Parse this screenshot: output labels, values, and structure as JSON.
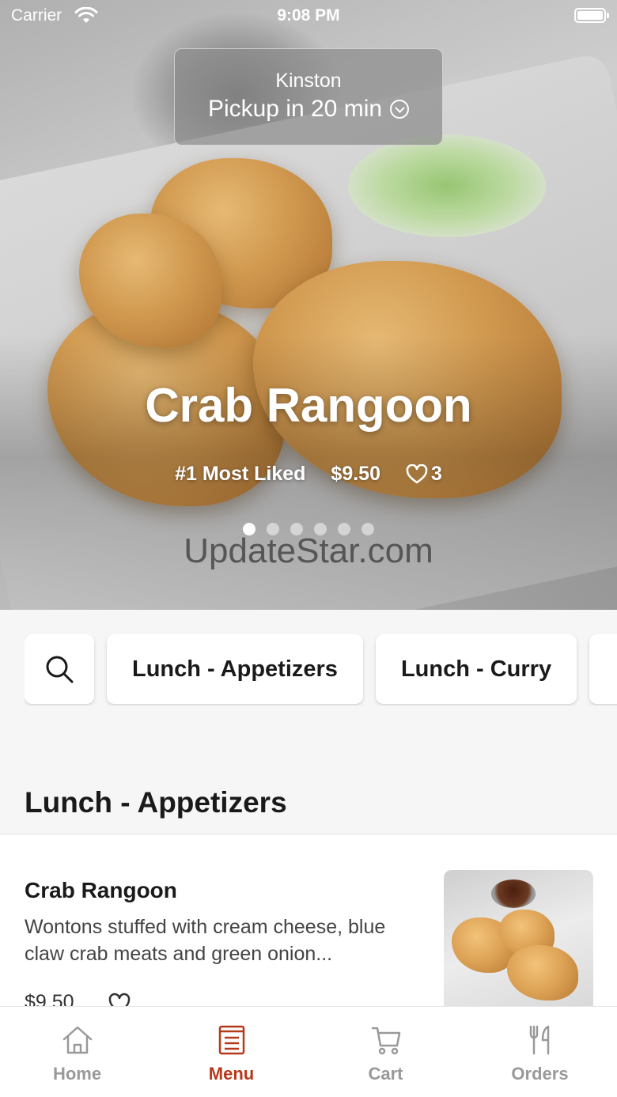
{
  "status_bar": {
    "carrier": "Carrier",
    "time": "9:08 PM"
  },
  "pickup": {
    "location": "Kinston",
    "eta": "Pickup in 20 min"
  },
  "hero": {
    "title": "Crab Rangoon",
    "rank": "#1 Most Liked",
    "price": "$9.50",
    "likes": "3",
    "slide_count": 6,
    "active_slide": 1,
    "watermark": "UpdateStar.com"
  },
  "categories": {
    "search_icon": "search-icon",
    "items": [
      "Lunch - Appetizers",
      "Lunch - Curry"
    ]
  },
  "section": {
    "title": "Lunch - Appetizers"
  },
  "menu_item": {
    "name": "Crab Rangoon",
    "description": "Wontons stuffed with cream cheese, blue claw crab meats and green onion...",
    "price": "$9.50"
  },
  "tabbar": {
    "items": [
      {
        "label": "Home",
        "icon": "home-icon"
      },
      {
        "label": "Menu",
        "icon": "menu-icon"
      },
      {
        "label": "Cart",
        "icon": "cart-icon"
      },
      {
        "label": "Orders",
        "icon": "orders-icon"
      }
    ],
    "active": "Menu"
  },
  "colors": {
    "accent": "#b5391a",
    "inactive": "#999999"
  }
}
